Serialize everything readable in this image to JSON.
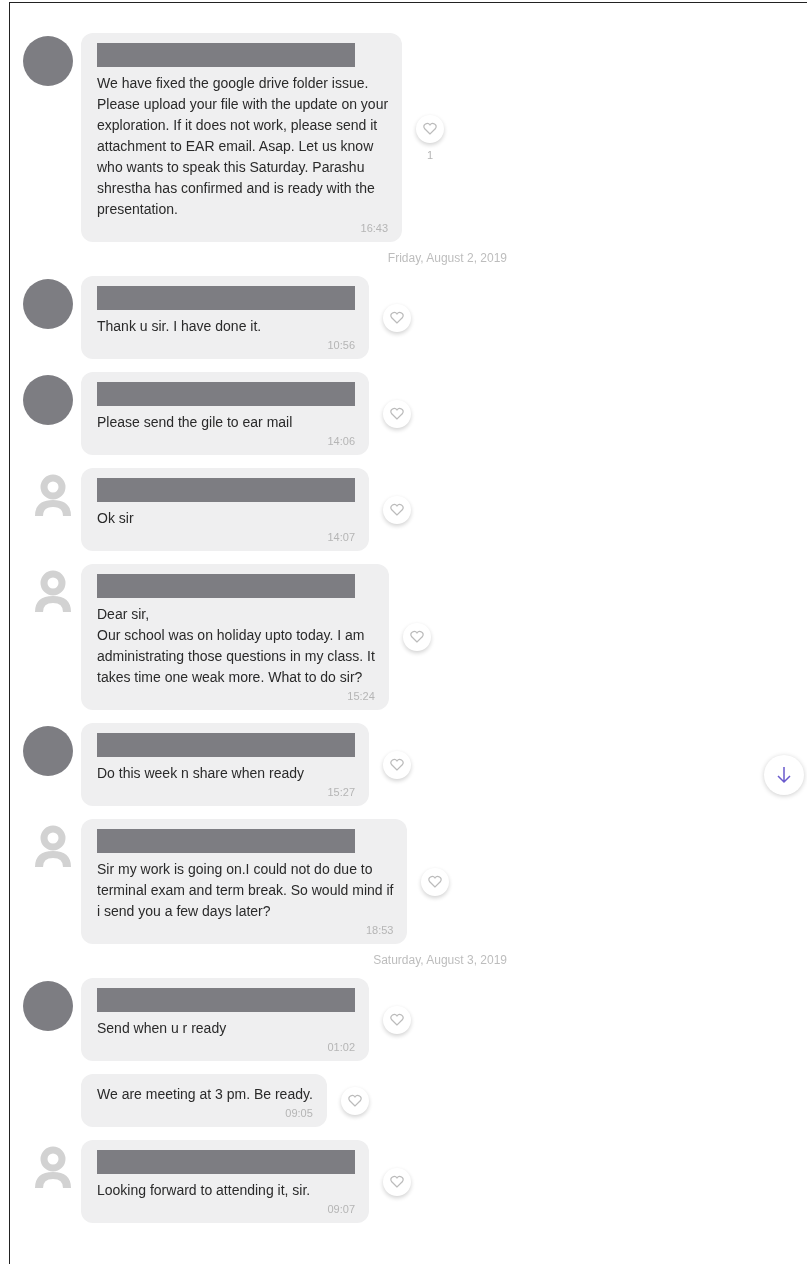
{
  "messages": [
    {
      "kind": "message",
      "avatar": {
        "kind": "blank"
      },
      "name_hidden": true,
      "text": "We have fixed the google drive folder issue.\nPlease upload your file with the update on your\nexploration. If it does not work, please send it\nattachment to EAR email. Asap. Let us know\nwho wants to speak this Saturday. Parashu\nshrestha has confirmed and is ready with the\npresentation.",
      "time": "16:43",
      "likes": "1"
    },
    {
      "kind": "date",
      "text": "Friday, August 2, 2019"
    },
    {
      "kind": "message",
      "avatar": {
        "kind": "blank"
      },
      "name_hidden": true,
      "text": "Thank u sir. I have done it.",
      "time": "10:56"
    },
    {
      "kind": "message",
      "avatar": {
        "kind": "blank"
      },
      "name_hidden": true,
      "text": "Please send the gile to ear mail",
      "time": "14:06"
    },
    {
      "kind": "message",
      "avatar": {
        "kind": "silhouette"
      },
      "name_hidden": true,
      "text": "Ok sir",
      "time": "14:07"
    },
    {
      "kind": "message",
      "avatar": {
        "kind": "silhouette"
      },
      "name_hidden": true,
      "text": "Dear sir,\nOur school was on holiday upto today. I am\nadministrating those questions in my class. It\ntakes time one weak more. What to do sir?",
      "time": "15:24"
    },
    {
      "kind": "message",
      "avatar": {
        "kind": "blank"
      },
      "name_hidden": true,
      "text": "Do this week n share when ready",
      "time": "15:27"
    },
    {
      "kind": "message",
      "avatar": {
        "kind": "silhouette"
      },
      "name_hidden": true,
      "text": "Sir my work is going on.I could not do due to\nterminal exam and term break. So would mind if\ni send you a few days later?",
      "time": "18:53"
    },
    {
      "kind": "date",
      "text": "Saturday, August 3, 2019"
    },
    {
      "kind": "message",
      "avatar": {
        "kind": "blank"
      },
      "name_hidden": true,
      "text": "Send when u r ready",
      "time": "01:02"
    },
    {
      "kind": "message",
      "name_hidden": false,
      "text": "We are meeting at 3 pm. Be ready.",
      "time": "09:05"
    },
    {
      "kind": "message",
      "avatar": {
        "kind": "silhouette"
      },
      "name_hidden": true,
      "text": "Looking forward to attending it, sir.",
      "time": "09:07"
    }
  ]
}
